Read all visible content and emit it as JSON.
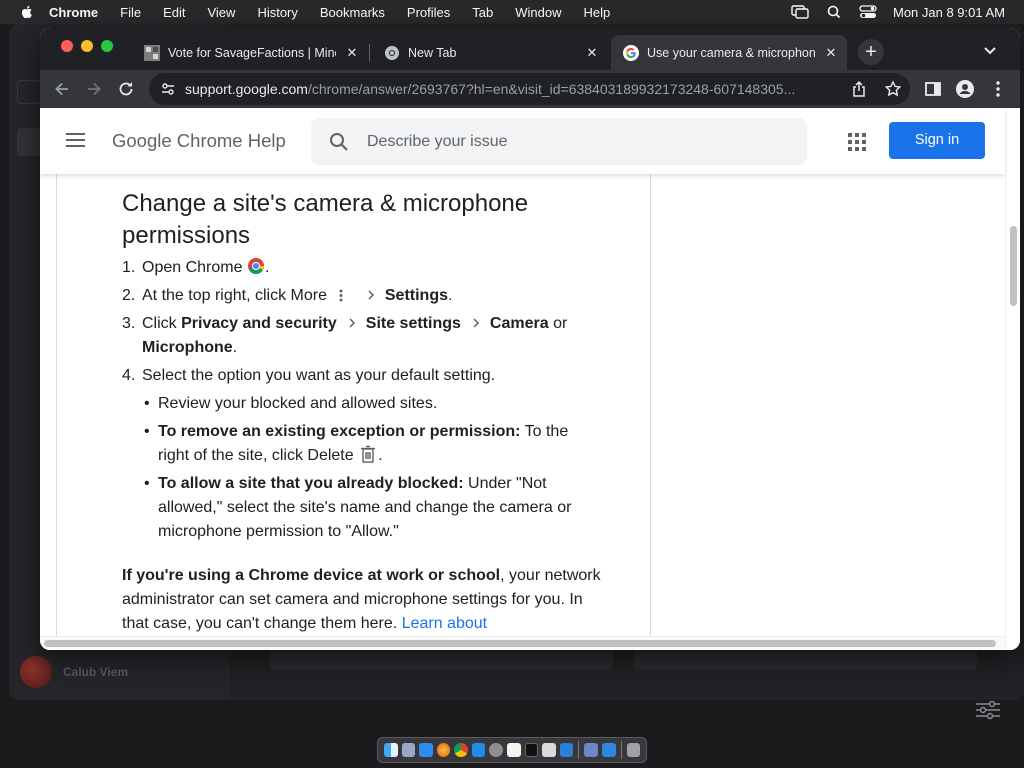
{
  "menubar": {
    "app_name": "Chrome",
    "menus": [
      "File",
      "Edit",
      "View",
      "History",
      "Bookmarks",
      "Profiles",
      "Tab",
      "Window",
      "Help"
    ],
    "clock": "Mon Jan 8  9:01 AM"
  },
  "tabs": [
    {
      "title": "Vote for SavageFactions | Mine",
      "icon": "minecraft-favicon"
    },
    {
      "title": "New Tab",
      "icon": "chrome-favicon"
    },
    {
      "title": "Use your camera & microphone",
      "icon": "google-favicon",
      "active": true
    }
  ],
  "omnibox": {
    "url_host": "support.google.com",
    "url_path": "/chrome/answer/2693767?hl=en&visit_id=638403189932173248-607148305..."
  },
  "header": {
    "product_name": "Google Chrome Help",
    "search_placeholder": "Describe your issue",
    "signin_label": "Sign in"
  },
  "article": {
    "heading": "Change a site's camera & microphone permissions",
    "steps": [
      {
        "num": "1.",
        "text": "Open Chrome"
      },
      {
        "num": "2.",
        "text": "At the top right, click More",
        "bold": "Settings"
      },
      {
        "num": "3.",
        "text": "Click",
        "bold_1": "Privacy and security",
        "bold_2": "Site settings",
        "bold_3": "Camera",
        "or": "or",
        "bold_4": "Microphone"
      },
      {
        "num": "4.",
        "text": "Select the option you want as your default setting."
      }
    ],
    "bullets": [
      {
        "text": "Review your blocked and allowed sites."
      },
      {
        "bold": "To remove an existing exception or permission:",
        "text": "To the right of the site, click Delete"
      },
      {
        "bold": "To allow a site that you already blocked:",
        "text": "Under \"Not allowed,\" select the site's name and change the camera or microphone permission to \"Allow.\""
      }
    ],
    "note": {
      "bold": "If you're using a Chrome device at work or school",
      "text": ", your network administrator can set camera and microphone settings for you. In that case, you can't change them here.",
      "link": "Learn about"
    }
  },
  "background_app": {
    "user_name": "Calub Viem"
  },
  "colors": {
    "accent": "#1a73e8",
    "tabstrip": "#202124",
    "toolbar": "#35363a"
  }
}
